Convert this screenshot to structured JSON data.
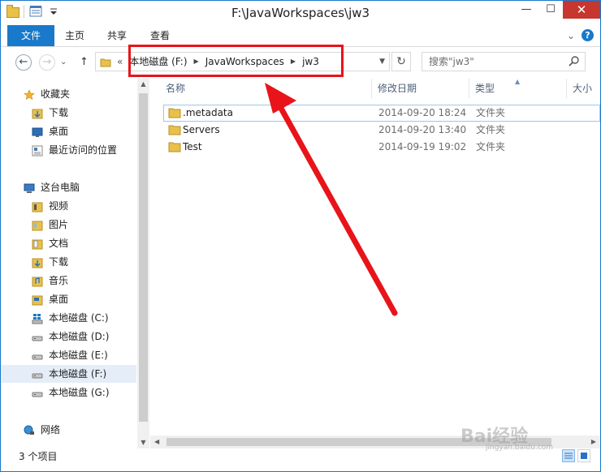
{
  "window": {
    "title": "F:\\JavaWorkspaces\\jw3",
    "minimize": "—",
    "maximize": "☐",
    "close": "✕"
  },
  "ribbon": {
    "tabs": [
      {
        "label": "文件"
      },
      {
        "label": "主页"
      },
      {
        "label": "共享"
      },
      {
        "label": "查看"
      }
    ],
    "help": "?",
    "expand": "⌄"
  },
  "nav": {
    "back": "←",
    "forward": "→",
    "up": "↑",
    "recent": "⌄",
    "breadcrumb": {
      "overflow": "«",
      "parts": [
        "本地磁盘 (F:)",
        "JavaWorkspaces",
        "jw3"
      ]
    },
    "refresh": "↻",
    "search_placeholder": "搜索\"jw3\""
  },
  "sidebar": {
    "favorites": {
      "label": "收藏夹",
      "items": [
        "下载",
        "桌面",
        "最近访问的位置"
      ]
    },
    "pc": {
      "label": "这台电脑",
      "items": [
        "视频",
        "图片",
        "文档",
        "下载",
        "音乐",
        "桌面",
        "本地磁盘 (C:)",
        "本地磁盘 (D:)",
        "本地磁盘 (E:)",
        "本地磁盘 (F:)",
        "本地磁盘 (G:)"
      ]
    },
    "network": {
      "label": "网络"
    },
    "selected": "本地磁盘 (F:)"
  },
  "columns": {
    "name": "名称",
    "modified": "修改日期",
    "type": "类型",
    "size": "大小"
  },
  "files": [
    {
      "name": ".metadata",
      "modified": "2014-09-20 18:24",
      "type": "文件夹"
    },
    {
      "name": "Servers",
      "modified": "2014-09-20 13:40",
      "type": "文件夹"
    },
    {
      "name": "Test",
      "modified": "2014-09-19 19:02",
      "type": "文件夹"
    }
  ],
  "status": {
    "count": "3 个项目"
  },
  "watermark": {
    "brand": "Bai经验",
    "url": "jingyan.baidu.com"
  },
  "colors": {
    "accent": "#1979ca",
    "annotation": "#e8141a",
    "folder": "#e8c14b",
    "close": "#c7372f"
  }
}
